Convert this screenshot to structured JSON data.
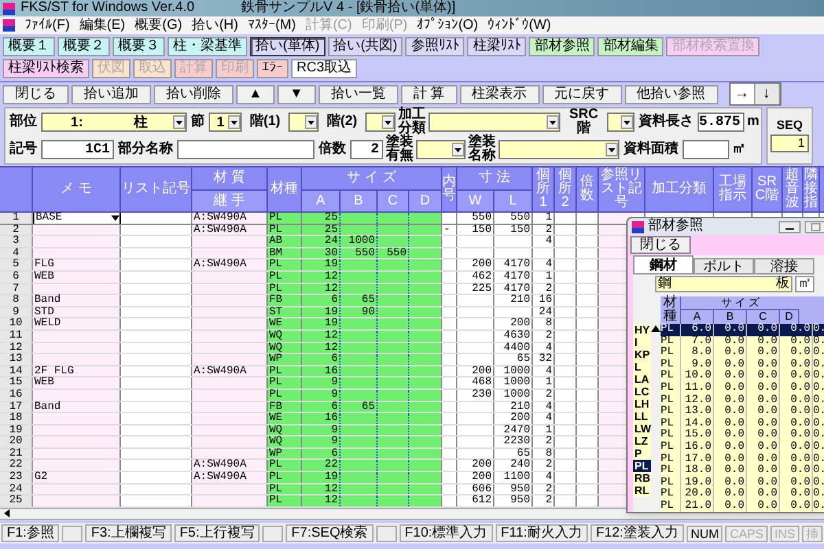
{
  "window": {
    "title": "FKS/ST for Windows Ver.4.0",
    "document": "鉄骨サンプルV 4 - [鉄骨拾い(単体)]"
  },
  "menu": [
    {
      "label": "ﾌｧｲﾙ(F)",
      "disabled": false
    },
    {
      "label": "編集(E)",
      "disabled": false
    },
    {
      "label": "概要(G)",
      "disabled": false
    },
    {
      "label": "拾い(H)",
      "disabled": false
    },
    {
      "label": "ﾏｽﾀｰ(M)",
      "disabled": false
    },
    {
      "label": "計算(C)",
      "disabled": true
    },
    {
      "label": "印刷(P)",
      "disabled": true
    },
    {
      "label": "ｵﾌﾟｼｮﾝ(O)",
      "disabled": false
    },
    {
      "label": "ｳｨﾝﾄﾞｳ(W)",
      "disabled": false
    }
  ],
  "toolbar": [
    {
      "label": "概要１",
      "color": "#c4f4f4",
      "disabled": false,
      "selected": false
    },
    {
      "label": "概要２",
      "color": "#c4f4f4",
      "disabled": false,
      "selected": false
    },
    {
      "label": "概要３",
      "color": "#c4f4f4",
      "disabled": false,
      "selected": false
    },
    {
      "label": "柱・梁基準",
      "color": "#c4f4f4",
      "disabled": false,
      "selected": false
    },
    {
      "label": "拾い(単体)",
      "color": "#d8d8f8",
      "disabled": false,
      "selected": true
    },
    {
      "label": "拾い(共図)",
      "color": "#d8d8f8",
      "disabled": false,
      "selected": false
    },
    {
      "label": "参照ﾘｽﾄ",
      "color": "#d8d8f8",
      "disabled": false,
      "selected": false
    },
    {
      "label": "柱梁ﾘｽﾄ",
      "color": "#d8d8f8",
      "disabled": false,
      "selected": false
    },
    {
      "label": "部材参照",
      "color": "#c4f4c4",
      "disabled": false,
      "selected": false
    },
    {
      "label": "部材編集",
      "color": "#c4f4c4",
      "disabled": false,
      "selected": false
    },
    {
      "label": "部材検索置換",
      "color": "#f8ccf4",
      "disabled": true,
      "selected": false
    },
    {
      "label": "柱梁ﾘｽﾄ検索",
      "color": "#f8ccf4",
      "disabled": false,
      "selected": false
    },
    {
      "label": "伏図",
      "color": "#fce2cc",
      "disabled": true,
      "selected": false
    },
    {
      "label": "取込",
      "color": "#fce2cc",
      "disabled": true,
      "selected": false
    },
    {
      "label": "計算",
      "color": "#f8cccc",
      "disabled": true,
      "selected": false
    },
    {
      "label": "印刷",
      "color": "#f8cccc",
      "disabled": true,
      "selected": false
    },
    {
      "label": "ｴﾗｰ",
      "color": "#f8cccc",
      "disabled": false,
      "selected": false
    },
    {
      "label": "RC3取込",
      "color": "#ffffff",
      "disabled": false,
      "selected": false
    }
  ],
  "actions": [
    "閉じる",
    "拾い追加",
    "拾い削除",
    "▲",
    "▼",
    "拾い一覧",
    "計 算",
    "柱梁表示",
    "元に戻す",
    "他拾い参照"
  ],
  "direction": [
    {
      "label": "→",
      "selected": true
    },
    {
      "label": "↓",
      "selected": false
    }
  ],
  "form": {
    "upper": [
      {
        "kind": "label",
        "text": "部位"
      },
      {
        "kind": "select",
        "values": [
          "1:",
          "柱"
        ]
      },
      {
        "kind": "label",
        "text": "節"
      },
      {
        "kind": "select",
        "values": [
          "1"
        ]
      },
      {
        "kind": "label",
        "text": "階(1)"
      },
      {
        "kind": "select"
      },
      {
        "kind": "label",
        "text": "階(2)"
      },
      {
        "kind": "select"
      },
      {
        "kind": "label",
        "text": "加工分類"
      },
      {
        "kind": "select"
      },
      {
        "kind": "label",
        "text": "SRC階"
      },
      {
        "kind": "select"
      },
      {
        "kind": "label",
        "text": "資料長さ"
      },
      {
        "kind": "input",
        "value": "5.875"
      },
      {
        "kind": "unit",
        "text": "m"
      }
    ],
    "lower": [
      {
        "kind": "label",
        "text": "記号"
      },
      {
        "kind": "input",
        "value": "1C1"
      },
      {
        "kind": "label",
        "text": "部分名称"
      },
      {
        "kind": "input"
      },
      {
        "kind": "label",
        "text": "倍数"
      },
      {
        "kind": "input",
        "value": "2"
      },
      {
        "kind": "label",
        "text": "塗装有無"
      },
      {
        "kind": "select"
      },
      {
        "kind": "label",
        "text": "塗装名称"
      },
      {
        "kind": "select"
      },
      {
        "kind": "label",
        "text": "資料面積"
      },
      {
        "kind": "input"
      },
      {
        "kind": "unit",
        "text": "㎡"
      }
    ],
    "seq": {
      "label": "SEQ",
      "value": "1"
    }
  },
  "table": {
    "columns": [
      {
        "label": "メ モ"
      },
      {
        "label": "リスト記号"
      },
      {
        "label": "材 質",
        "sub": [
          "継 手"
        ]
      },
      {
        "label": "材種"
      },
      {
        "label": "サ イ ズ",
        "sub": [
          "A",
          "B",
          "C",
          "D"
        ]
      },
      {
        "label": "内号"
      },
      {
        "label": "寸 法",
        "sub": [
          "W",
          "L"
        ]
      },
      {
        "label": "個所1"
      },
      {
        "label": "個所2"
      },
      {
        "label": "倍数"
      },
      {
        "label": "参照リスト記号"
      },
      {
        "label": "加工分類"
      },
      {
        "label": "工場指示"
      },
      {
        "label": "SRC階"
      },
      {
        "label": "超音波"
      },
      {
        "label": "隣接指"
      }
    ],
    "rows": [
      {
        "no": "1",
        "memo": "BASE",
        "material": "A:SW490A",
        "type": "PL",
        "a": "25",
        "w": "550",
        "l": "550",
        "count1": "1",
        "selected": true
      },
      {
        "no": "2",
        "material": "A:SW490A",
        "type": "PL",
        "a": "25",
        "inner": "-",
        "w": "150",
        "l": "150",
        "count1": "2",
        "selected": false
      },
      {
        "no": "3",
        "type": "AB",
        "a": "24",
        "b": "1000",
        "count1": "4",
        "selected": false
      },
      {
        "no": "4",
        "type": "BM",
        "a": "30",
        "b": "550",
        "c": "550",
        "selected": false
      },
      {
        "no": "5",
        "memo": "FLG",
        "material": "A:SW490A",
        "type": "PL",
        "a": "19",
        "w": "200",
        "l": "4170",
        "count1": "4",
        "selected": false
      },
      {
        "no": "6",
        "memo": "WEB",
        "type": "PL",
        "a": "12",
        "w": "462",
        "l": "4170",
        "count1": "1",
        "selected": false
      },
      {
        "no": "7",
        "type": "PL",
        "a": "12",
        "w": "225",
        "l": "4170",
        "count1": "2",
        "selected": false
      },
      {
        "no": "8",
        "memo": "Band",
        "type": "FB",
        "a": "6",
        "b": "65",
        "l": "210",
        "count1": "16",
        "selected": false
      },
      {
        "no": "9",
        "memo": "STD",
        "type": "ST",
        "a": "19",
        "b": "90",
        "count1": "24",
        "selected": false
      },
      {
        "no": "10",
        "memo": "WELD",
        "type": "WE",
        "a": "19",
        "l": "200",
        "count1": "8",
        "selected": false
      },
      {
        "no": "11",
        "type": "WQ",
        "a": "12",
        "l": "4630",
        "count1": "2",
        "selected": false
      },
      {
        "no": "12",
        "type": "WQ",
        "a": "12",
        "l": "4400",
        "count1": "4",
        "selected": false
      },
      {
        "no": "13",
        "type": "WP",
        "a": "6",
        "l": "65",
        "count1": "32",
        "selected": false
      },
      {
        "no": "14",
        "memo": "2F FLG",
        "material": "A:SW490A",
        "type": "PL",
        "a": "16",
        "w": "200",
        "l": "1000",
        "count1": "4",
        "selected": false
      },
      {
        "no": "15",
        "memo": "WEB",
        "type": "PL",
        "a": "9",
        "w": "468",
        "l": "1000",
        "count1": "1",
        "selected": false
      },
      {
        "no": "16",
        "type": "PL",
        "a": "9",
        "w": "230",
        "l": "1000",
        "count1": "2",
        "selected": false
      },
      {
        "no": "17",
        "memo": "Band",
        "type": "FB",
        "a": "6",
        "b": "65",
        "l": "210",
        "count1": "4",
        "selected": false
      },
      {
        "no": "18",
        "type": "WE",
        "a": "16",
        "l": "200",
        "count1": "4",
        "selected": false
      },
      {
        "no": "19",
        "type": "WQ",
        "a": "9",
        "l": "2470",
        "count1": "1",
        "selected": false
      },
      {
        "no": "20",
        "type": "WQ",
        "a": "9",
        "l": "2230",
        "count1": "2",
        "selected": false
      },
      {
        "no": "21",
        "type": "WP",
        "a": "6",
        "l": "65",
        "count1": "8",
        "selected": false
      },
      {
        "no": "22",
        "material": "A:SW490A",
        "type": "PL",
        "a": "22",
        "w": "200",
        "l": "240",
        "count1": "2",
        "selected": false
      },
      {
        "no": "23",
        "memo": "G2",
        "material": "A:SW490A",
        "type": "PL",
        "a": "19",
        "w": "200",
        "l": "1100",
        "count1": "4",
        "selected": false
      },
      {
        "no": "24",
        "type": "PL",
        "a": "12",
        "w": "606",
        "l": "950",
        "count1": "2",
        "selected": false
      },
      {
        "no": "25",
        "type": "PL",
        "a": "12",
        "w": "612",
        "l": "950",
        "count1": "2",
        "selected": false
      }
    ]
  },
  "ref_window": {
    "title": "部材参照",
    "close": "閉じる",
    "tabs": [
      {
        "label": "鋼材",
        "selected": true
      },
      {
        "label": "ボルト",
        "selected": false
      },
      {
        "label": "溶接",
        "selected": false
      }
    ],
    "search": {
      "value": "鋼",
      "suffix": "板",
      "unit": "㎡"
    },
    "types": [
      {
        "label": "HY",
        "selected": false
      },
      {
        "label": "I",
        "selected": false
      },
      {
        "label": "KP",
        "selected": false
      },
      {
        "label": "L",
        "selected": false
      },
      {
        "label": "LA",
        "selected": false
      },
      {
        "label": "LC",
        "selected": false
      },
      {
        "label": "LH",
        "selected": false
      },
      {
        "label": "LL",
        "selected": false
      },
      {
        "label": "LW",
        "selected": false
      },
      {
        "label": "LZ",
        "selected": false
      },
      {
        "label": "P",
        "selected": false
      },
      {
        "label": "PL",
        "selected": true
      },
      {
        "label": "RB",
        "selected": false
      },
      {
        "label": "RL",
        "selected": false
      }
    ],
    "columns": {
      "type": "材種",
      "group": "サ イ ズ",
      "sub": [
        "A",
        "B",
        "C",
        "D"
      ]
    },
    "rows": [
      {
        "cells": [
          "PL",
          "6.0",
          "0.0",
          "0.0",
          "0.0",
          "0."
        ],
        "selected": true
      },
      {
        "cells": [
          "PL",
          "7.0",
          "0.0",
          "0.0",
          "0.0",
          "0."
        ],
        "selected": false
      },
      {
        "cells": [
          "PL",
          "8.0",
          "0.0",
          "0.0",
          "0.0",
          "0."
        ],
        "selected": false
      },
      {
        "cells": [
          "PL",
          "9.0",
          "0.0",
          "0.0",
          "0.0",
          "0."
        ],
        "selected": false
      },
      {
        "cells": [
          "PL",
          "10.0",
          "0.0",
          "0.0",
          "0.0",
          "0."
        ],
        "selected": false
      },
      {
        "cells": [
          "PL",
          "11.0",
          "0.0",
          "0.0",
          "0.0",
          "0."
        ],
        "selected": false
      },
      {
        "cells": [
          "PL",
          "12.0",
          "0.0",
          "0.0",
          "0.0",
          "0."
        ],
        "selected": false
      },
      {
        "cells": [
          "PL",
          "13.0",
          "0.0",
          "0.0",
          "0.0",
          "0."
        ],
        "selected": false
      },
      {
        "cells": [
          "PL",
          "14.0",
          "0.0",
          "0.0",
          "0.0",
          "0."
        ],
        "selected": false
      },
      {
        "cells": [
          "PL",
          "15.0",
          "0.0",
          "0.0",
          "0.0",
          "0."
        ],
        "selected": false
      },
      {
        "cells": [
          "PL",
          "16.0",
          "0.0",
          "0.0",
          "0.0",
          "0."
        ],
        "selected": false
      },
      {
        "cells": [
          "PL",
          "17.0",
          "0.0",
          "0.0",
          "0.0",
          "0."
        ],
        "selected": false
      },
      {
        "cells": [
          "PL",
          "18.0",
          "0.0",
          "0.0",
          "0.0",
          "0."
        ],
        "selected": false
      },
      {
        "cells": [
          "PL",
          "19.0",
          "0.0",
          "0.0",
          "0.0",
          "0."
        ],
        "selected": false
      },
      {
        "cells": [
          "PL",
          "20.0",
          "0.0",
          "0.0",
          "0.0",
          "0."
        ],
        "selected": false
      },
      {
        "cells": [
          "PL",
          "21.0",
          "0.0",
          "0.0",
          "0.0",
          "0."
        ],
        "selected": false
      }
    ]
  },
  "status_bar": [
    {
      "kind": "key",
      "label": "F1:参照"
    },
    {
      "kind": "blank"
    },
    {
      "kind": "key",
      "label": "F3:上欄複写"
    },
    {
      "kind": "key",
      "label": "F5:上行複写"
    },
    {
      "kind": "blank"
    },
    {
      "kind": "key",
      "label": "F7:SEQ検索"
    },
    {
      "kind": "blank"
    },
    {
      "kind": "key",
      "label": "F10:標準入力"
    },
    {
      "kind": "key",
      "label": "F11:耐火入力"
    },
    {
      "kind": "key",
      "label": "F12:塗装入力"
    },
    {
      "kind": "indicator",
      "label": "NUM",
      "on": true
    },
    {
      "kind": "indicator",
      "label": "CAPS",
      "on": false
    },
    {
      "kind": "indicator",
      "label": "INS",
      "on": false
    },
    {
      "kind": "indicator",
      "label": "挿",
      "on": false
    }
  ]
}
